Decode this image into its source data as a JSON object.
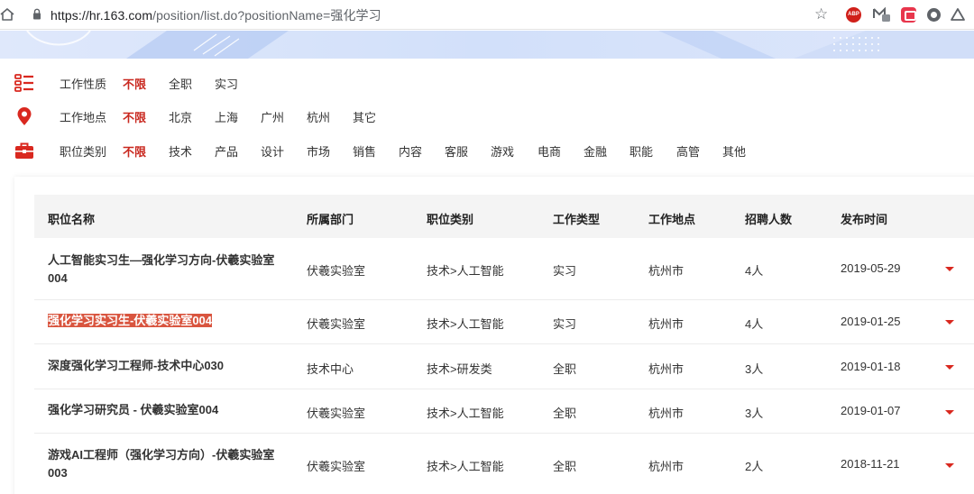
{
  "browser": {
    "url_host": "https://hr.163.com",
    "url_path": "/position/list.do?positionName=强化学习",
    "ext_abp": "ABP"
  },
  "filters": {
    "nature": {
      "label": "工作性质",
      "options": [
        "不限",
        "全职",
        "实习"
      ]
    },
    "location": {
      "label": "工作地点",
      "options": [
        "不限",
        "北京",
        "上海",
        "广州",
        "杭州",
        "其它"
      ]
    },
    "category": {
      "label": "职位类别",
      "options": [
        "不限",
        "技术",
        "产品",
        "设计",
        "市场",
        "销售",
        "内容",
        "客服",
        "游戏",
        "电商",
        "金融",
        "职能",
        "高管",
        "其他"
      ]
    }
  },
  "table": {
    "headers": [
      "职位名称",
      "所属部门",
      "职位类别",
      "工作类型",
      "工作地点",
      "招聘人数",
      "发布时间"
    ],
    "rows": [
      {
        "title": "人工智能实习生—强化学习方向-伏羲实验室004",
        "dept": "伏羲实验室",
        "category": "技术>人工智能",
        "type": "实习",
        "location": "杭州市",
        "count": "4人",
        "date": "2019-05-29"
      },
      {
        "title": "强化学习实习生-伏羲实验室004",
        "dept": "伏羲实验室",
        "category": "技术>人工智能",
        "type": "实习",
        "location": "杭州市",
        "count": "4人",
        "date": "2019-01-25"
      },
      {
        "title": "深度强化学习工程师-技术中心030",
        "dept": "技术中心",
        "category": "技术>研发类",
        "type": "全职",
        "location": "杭州市",
        "count": "3人",
        "date": "2019-01-18"
      },
      {
        "title": "强化学习研究员 - 伏羲实验室004",
        "dept": "伏羲实验室",
        "category": "技术>人工智能",
        "type": "全职",
        "location": "杭州市",
        "count": "3人",
        "date": "2019-01-07"
      },
      {
        "title": "游戏AI工程师（强化学习方向）-伏羲实验室003",
        "dept": "伏羲实验室",
        "category": "技术>人工智能",
        "type": "全职",
        "location": "杭州市",
        "count": "2人",
        "date": "2018-11-21"
      }
    ]
  },
  "colors": {
    "accent": "#c9281f",
    "highlight": "#d9553f",
    "header_bg": "#f4f4f4"
  }
}
